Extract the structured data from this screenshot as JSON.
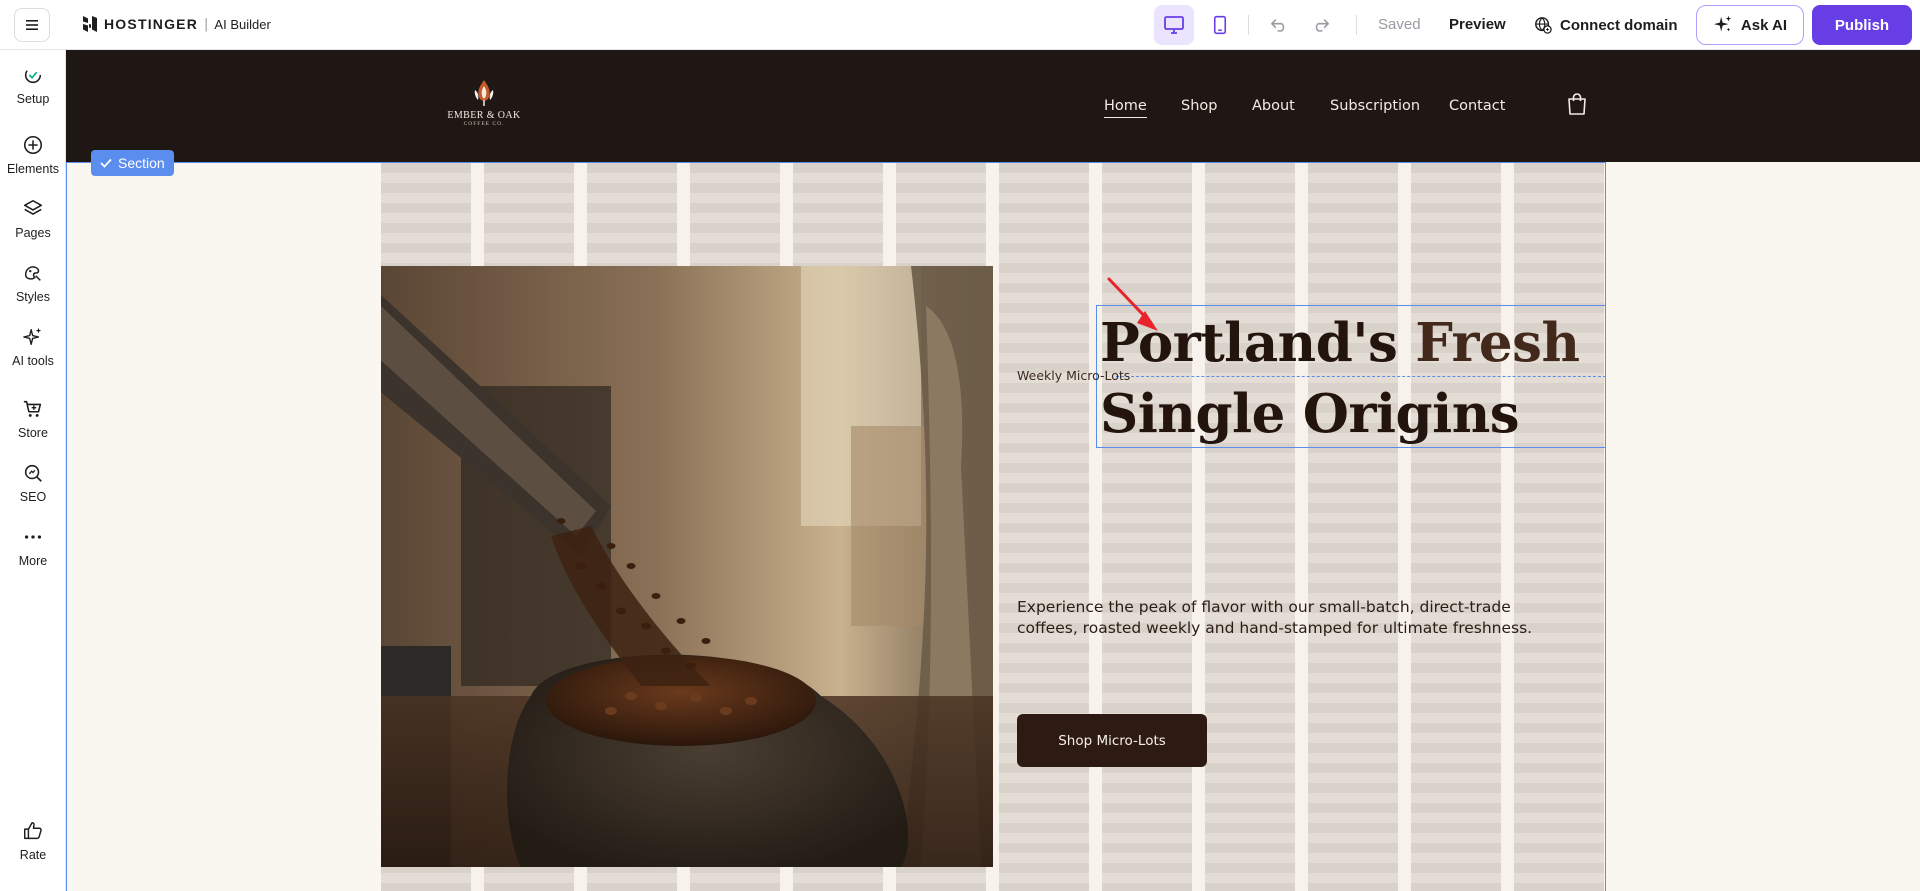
{
  "topbar": {
    "brand_name": "HOSTINGER",
    "brand_separator": "|",
    "brand_product": "AI Builder",
    "saved_label": "Saved",
    "preview_label": "Preview",
    "connect_domain_label": "Connect domain",
    "ask_ai_label": "Ask AI",
    "publish_label": "Publish"
  },
  "sidebar": {
    "items": [
      {
        "label": "Setup",
        "icon": "setup-icon"
      },
      {
        "label": "Elements",
        "icon": "plus-circle-icon"
      },
      {
        "label": "Pages",
        "icon": "layers-icon"
      },
      {
        "label": "Styles",
        "icon": "palette-icon"
      },
      {
        "label": "AI tools",
        "icon": "sparkles-icon"
      },
      {
        "label": "Store",
        "icon": "cart-icon"
      },
      {
        "label": "SEO",
        "icon": "seo-search-icon"
      },
      {
        "label": "More",
        "icon": "more-dots-icon"
      }
    ],
    "rate_label": "Rate"
  },
  "site": {
    "logo_name": "EMBER & OAK",
    "logo_sub": "COFFEE CO.",
    "nav": [
      "Home",
      "Shop",
      "About",
      "Subscription",
      "Contact"
    ],
    "active_nav": "Home"
  },
  "editor": {
    "section_tag": "Section"
  },
  "hero": {
    "heading_part1": "Portland's ",
    "heading_accent": "Fresh",
    "heading_line2": "Single Origins",
    "eyebrow": "Weekly Micro-Lots",
    "description": "Experience the peak of flavor with our small-batch, direct-trade coffees, roasted weekly and hand-stamped for ultimate freshness.",
    "cta_label": "Shop Micro-Lots"
  },
  "colors": {
    "brand_purple": "#673de6",
    "selection_blue": "#5b8def",
    "site_header_bg": "#1f1713",
    "canvas_bg": "#faf6f0",
    "cta_bg": "#2d1a12",
    "annotation_arrow": "#e8232b"
  }
}
